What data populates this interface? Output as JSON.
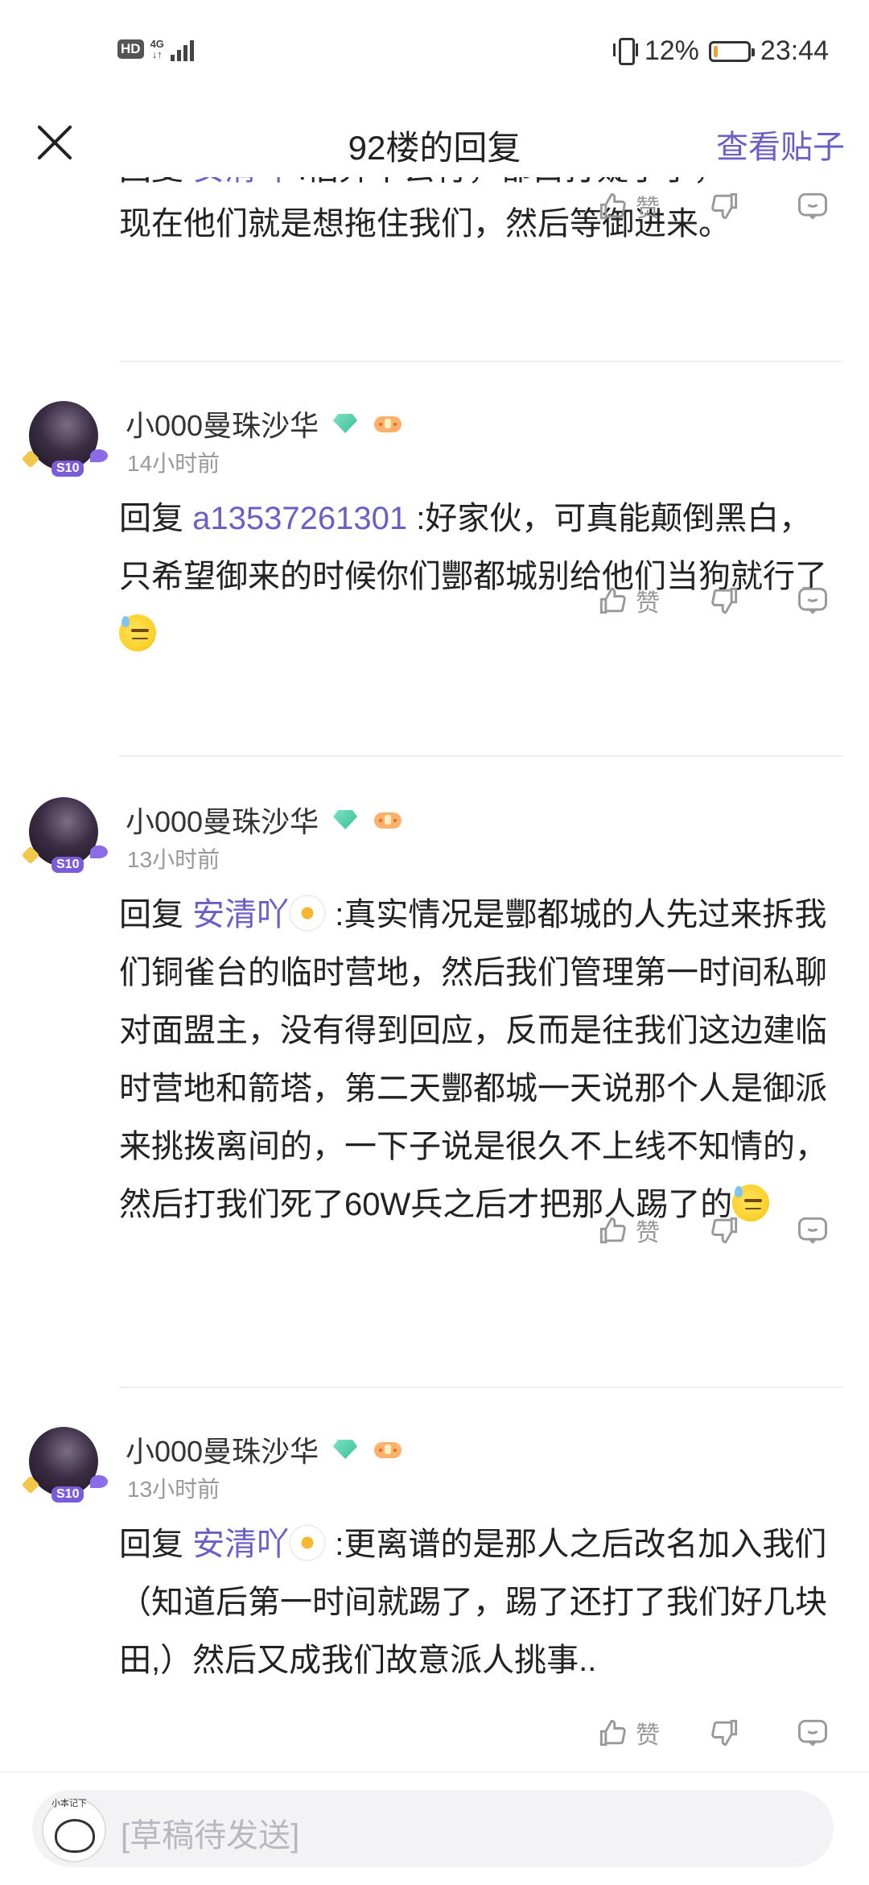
{
  "status_bar": {
    "hd": "HD",
    "network": "4G",
    "battery": "12%",
    "battery_level": 0.12,
    "time": "23:44"
  },
  "header": {
    "title": "92楼的回复",
    "view_post": "查看贴子"
  },
  "partial_comment": {
    "line1_prefix": "回复 ",
    "line1_name": "安清吖",
    "line1_rest": " :估弃下去行，都白打疑了了，",
    "line2": "现在他们就是想拖住我们，然后等御进来。"
  },
  "actions": {
    "like_label": "赞"
  },
  "comments": [
    {
      "username": "小000曼珠沙华",
      "avatar_badge": "S10",
      "time": "14小时前",
      "reply_prefix": "回复",
      "reply_to": "a13537261301",
      "text": " :好家伙，可真能颠倒黑白，只希望御来的时候你们酆都城别给他们当狗就行了"
    },
    {
      "username": "小000曼珠沙华",
      "avatar_badge": "S10",
      "time": "13小时前",
      "reply_prefix": "回复",
      "reply_to": "安清吖",
      "text": " :真实情况是酆都城的人先过来拆我们铜雀台的临时营地，然后我们管理第一时间私聊对面盟主，没有得到回应，反而是往我们这边建临时营地和箭塔，第二天酆都城一天说那个人是御派来挑拨离间的，一下子说是很久不上线不知情的，然后打我们死了60W兵之后才把那人踢了的"
    },
    {
      "username": "小000曼珠沙华",
      "avatar_badge": "S10",
      "time": "13小时前",
      "reply_prefix": "回复",
      "reply_to": "安清吖",
      "text": " :更离谱的是那人之后改名加入我们（知道后第一时间就踢了，踢了还打了我们好几块田,）然后又成我们故意派人挑事.."
    }
  ],
  "composer": {
    "avatar_tag": "小本记下",
    "placeholder": "[草稿待发送]"
  },
  "colors": {
    "accent": "#6a5fc8",
    "battery": "#f2a22e",
    "muted": "#999999"
  }
}
